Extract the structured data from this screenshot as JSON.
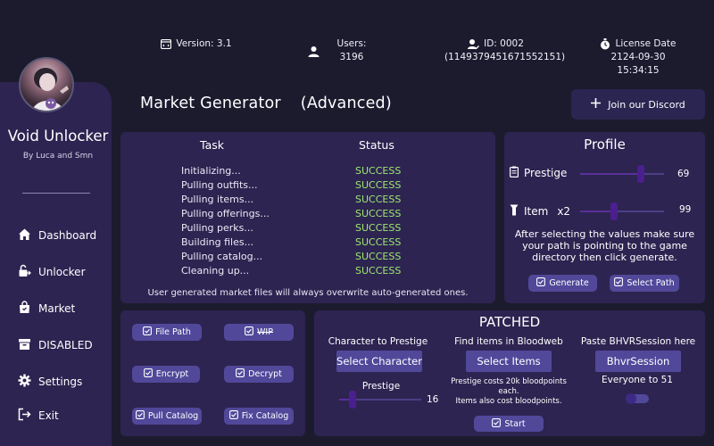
{
  "header": {
    "version": {
      "label": "Version: 3.1",
      "icon": "version-icon"
    },
    "users": {
      "label": "Users: 3196",
      "icon": "user-icon"
    },
    "id": {
      "label": "ID: 0002",
      "value": "(1149379451671552151)",
      "icon": "id-icon"
    },
    "license": {
      "label": "License Date",
      "value": "2124-09-30 15:34:15",
      "icon": "clock-icon"
    }
  },
  "sidebar": {
    "title": "Void Unlocker",
    "subtitle": "By Luca and Smn",
    "items": [
      {
        "label": "Dashboard",
        "icon": "home-icon"
      },
      {
        "label": "Unlocker",
        "icon": "unlock-icon"
      },
      {
        "label": "Market",
        "icon": "bag-icon"
      },
      {
        "label": "DISABLED",
        "icon": "box-icon"
      },
      {
        "label": "Settings",
        "icon": "gear-icon"
      },
      {
        "label": "Exit",
        "icon": "exit-icon"
      }
    ]
  },
  "page": {
    "title": "Market Generator",
    "subtitle": "(Advanced)",
    "discord_label": "Join our Discord"
  },
  "tasks": {
    "task_header": "Task",
    "status_header": "Status",
    "rows": [
      {
        "task": "Initializing...",
        "status": "SUCCESS"
      },
      {
        "task": "Pulling outfits...",
        "status": "SUCCESS"
      },
      {
        "task": "Pulling items...",
        "status": "SUCCESS"
      },
      {
        "task": "Pulling offerings...",
        "status": "SUCCESS"
      },
      {
        "task": "Pulling perks...",
        "status": "SUCCESS"
      },
      {
        "task": "Building files...",
        "status": "SUCCESS"
      },
      {
        "task": "Pulling catalog...",
        "status": "SUCCESS"
      },
      {
        "task": "Cleaning up...",
        "status": "SUCCESS"
      }
    ],
    "note": "User generated market files will always overwrite auto-generated ones."
  },
  "profile": {
    "title": "Profile",
    "prestige_label": "Prestige",
    "prestige_value": "69",
    "prestige_fraction": 0.72,
    "item_label": "Item",
    "item_multiplier": "x2",
    "item_value": "99",
    "item_fraction": 0.4,
    "note": "After selecting the values make sure your path is pointing to   the   game directory then click generate.",
    "generate_label": "Generate",
    "select_path_label": "Select Path"
  },
  "tools": {
    "file_path": "File Path",
    "wip": "WIP",
    "encrypt": "Encrypt",
    "decrypt": "Decrypt",
    "pull_catalog": "Pull Catalog",
    "fix_catalog": "Fix Catalog"
  },
  "patched": {
    "title": "PATCHED",
    "character_label": "Character to Prestige",
    "select_character": "Select Character",
    "prestige_label": "Prestige",
    "prestige_value": "16",
    "prestige_fraction": 0.16,
    "items_label": "Find items in Bloodweb",
    "select_items": "Select Items",
    "items_note_1": "Prestige costs 20k bloodpoints",
    "items_note_2": "each.",
    "items_note_3": "Items also cost bloodpoints.",
    "session_label": "Paste BHVRSession here",
    "session_button": "BhvrSession",
    "everyone_label": "Everyone to 51",
    "start_label": "Start"
  },
  "colors": {
    "background": "#1c1b2e",
    "panel": "#2d2451",
    "button": "#51489a",
    "success": "#9fe870"
  }
}
